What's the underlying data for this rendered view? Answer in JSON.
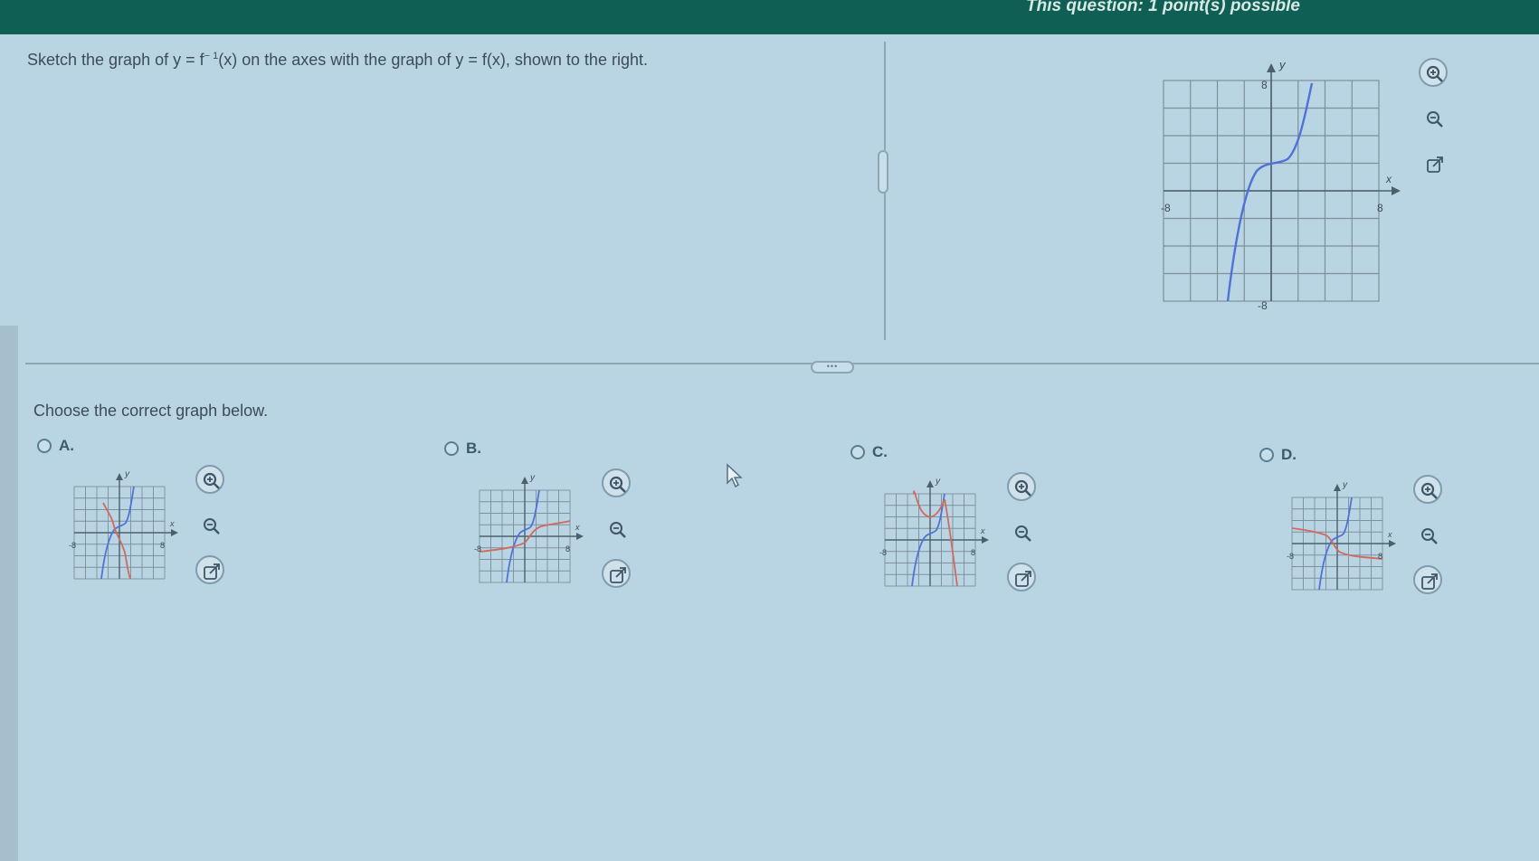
{
  "header": {
    "question_info": "This question: 1 point(s) possible"
  },
  "prompt": {
    "part1": "Sketch the graph of y = f",
    "superscript": "− 1",
    "part2": "(x) on the axes with the graph of y = f(x), shown to the right."
  },
  "choose_label": "Choose the correct graph below.",
  "options": [
    {
      "letter": "A.",
      "graph_description": "blue curve and red curve, red with vertical tangent near origin"
    },
    {
      "letter": "B.",
      "graph_description": "blue curve and red curve, red with horizontal flat near origin"
    },
    {
      "letter": "C.",
      "graph_description": "blue steep curve with red dome-shaped curve"
    },
    {
      "letter": "D.",
      "graph_description": "blue curve with red decreasing curve"
    }
  ],
  "reference_graph": {
    "axis_x_label": "x",
    "axis_y_label": "y",
    "tick_left": "-8",
    "tick_right": "8",
    "tick_top": "8",
    "tick_bottom": "-8"
  },
  "option_axis_labels": {
    "x": "x",
    "y": "y",
    "pos": "8",
    "neg": "-8"
  },
  "tool_icons": [
    "zoom-in-icon",
    "zoom-out-icon",
    "open-in-new-window-icon"
  ],
  "colors": {
    "header_bg": "#0f5f55",
    "page_bg": "#b9d5e3",
    "curve_blue": "#4f72d8",
    "curve_red": "#d06a5e",
    "grid": "#7d909b"
  }
}
